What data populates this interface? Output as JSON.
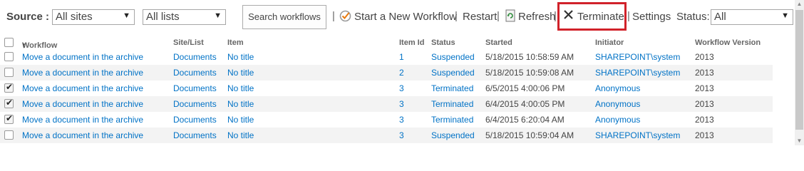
{
  "toolbar": {
    "source_label": "Source :",
    "sites_select": "All sites",
    "lists_select": "All lists",
    "search_button": "Search workflows",
    "start_workflow": "Start a New Workflow",
    "restart": "Restart",
    "refresh": "Refresh",
    "terminate": "Terminate",
    "settings": "Settings",
    "status_label": "Status:",
    "status_select": "All",
    "separator": "|"
  },
  "columns": {
    "workflow": "Workflow",
    "sort_arrow": "↑",
    "site_list": "Site/List",
    "item": "Item",
    "item_id": "Item Id",
    "status": "Status",
    "started": "Started",
    "initiator": "Initiator",
    "version": "Workflow Version"
  },
  "rows": [
    {
      "checked": false,
      "workflow": "Move a document in the archive",
      "site_list": "Documents",
      "item": "No title",
      "item_id": "1",
      "status": "Suspended",
      "started": "5/18/2015 10:58:59 AM",
      "initiator": "SHAREPOINT\\system",
      "initiator_link": true,
      "version": "2013"
    },
    {
      "checked": false,
      "workflow": "Move a document in the archive",
      "site_list": "Documents",
      "item": "No title",
      "item_id": "2",
      "status": "Suspended",
      "started": "5/18/2015 10:59:08 AM",
      "initiator": "SHAREPOINT\\system",
      "initiator_link": true,
      "version": "2013"
    },
    {
      "checked": true,
      "workflow": "Move a document in the archive",
      "site_list": "Documents",
      "item": "No title",
      "item_id": "3",
      "status": "Terminated",
      "started": "6/5/2015 4:00:06 PM",
      "initiator": "Anonymous",
      "initiator_link": true,
      "version": "2013"
    },
    {
      "checked": true,
      "workflow": "Move a document in the archive",
      "site_list": "Documents",
      "item": "No title",
      "item_id": "3",
      "status": "Terminated",
      "started": "6/4/2015 4:00:05 PM",
      "initiator": "Anonymous",
      "initiator_link": true,
      "version": "2013"
    },
    {
      "checked": true,
      "workflow": "Move a document in the archive",
      "site_list": "Documents",
      "item": "No title",
      "item_id": "3",
      "status": "Terminated",
      "started": "6/4/2015 6:20:04 AM",
      "initiator": "Anonymous",
      "initiator_link": true,
      "version": "2013"
    },
    {
      "checked": false,
      "workflow": "Move a document in the archive",
      "site_list": "Documents",
      "item": "No title",
      "item_id": "3",
      "status": "Suspended",
      "started": "5/18/2015 10:59:04 AM",
      "initiator": "SHAREPOINT\\system",
      "initiator_link": true,
      "version": "2013"
    }
  ],
  "colors": {
    "link": "#0072c6",
    "text": "#444444",
    "highlight": "#d1222a",
    "alt_row": "#f3f3f3"
  }
}
